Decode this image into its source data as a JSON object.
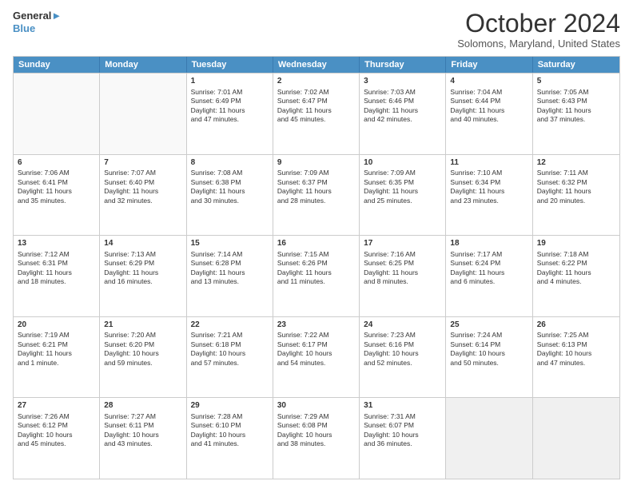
{
  "logo": {
    "line1": "General",
    "line2": "Blue"
  },
  "title": "October 2024",
  "subtitle": "Solomons, Maryland, United States",
  "headers": [
    "Sunday",
    "Monday",
    "Tuesday",
    "Wednesday",
    "Thursday",
    "Friday",
    "Saturday"
  ],
  "rows": [
    [
      {
        "day": "",
        "lines": [],
        "empty": true
      },
      {
        "day": "",
        "lines": [],
        "empty": true
      },
      {
        "day": "1",
        "lines": [
          "Sunrise: 7:01 AM",
          "Sunset: 6:49 PM",
          "Daylight: 11 hours",
          "and 47 minutes."
        ]
      },
      {
        "day": "2",
        "lines": [
          "Sunrise: 7:02 AM",
          "Sunset: 6:47 PM",
          "Daylight: 11 hours",
          "and 45 minutes."
        ]
      },
      {
        "day": "3",
        "lines": [
          "Sunrise: 7:03 AM",
          "Sunset: 6:46 PM",
          "Daylight: 11 hours",
          "and 42 minutes."
        ]
      },
      {
        "day": "4",
        "lines": [
          "Sunrise: 7:04 AM",
          "Sunset: 6:44 PM",
          "Daylight: 11 hours",
          "and 40 minutes."
        ]
      },
      {
        "day": "5",
        "lines": [
          "Sunrise: 7:05 AM",
          "Sunset: 6:43 PM",
          "Daylight: 11 hours",
          "and 37 minutes."
        ]
      }
    ],
    [
      {
        "day": "6",
        "lines": [
          "Sunrise: 7:06 AM",
          "Sunset: 6:41 PM",
          "Daylight: 11 hours",
          "and 35 minutes."
        ]
      },
      {
        "day": "7",
        "lines": [
          "Sunrise: 7:07 AM",
          "Sunset: 6:40 PM",
          "Daylight: 11 hours",
          "and 32 minutes."
        ]
      },
      {
        "day": "8",
        "lines": [
          "Sunrise: 7:08 AM",
          "Sunset: 6:38 PM",
          "Daylight: 11 hours",
          "and 30 minutes."
        ]
      },
      {
        "day": "9",
        "lines": [
          "Sunrise: 7:09 AM",
          "Sunset: 6:37 PM",
          "Daylight: 11 hours",
          "and 28 minutes."
        ]
      },
      {
        "day": "10",
        "lines": [
          "Sunrise: 7:09 AM",
          "Sunset: 6:35 PM",
          "Daylight: 11 hours",
          "and 25 minutes."
        ]
      },
      {
        "day": "11",
        "lines": [
          "Sunrise: 7:10 AM",
          "Sunset: 6:34 PM",
          "Daylight: 11 hours",
          "and 23 minutes."
        ]
      },
      {
        "day": "12",
        "lines": [
          "Sunrise: 7:11 AM",
          "Sunset: 6:32 PM",
          "Daylight: 11 hours",
          "and 20 minutes."
        ]
      }
    ],
    [
      {
        "day": "13",
        "lines": [
          "Sunrise: 7:12 AM",
          "Sunset: 6:31 PM",
          "Daylight: 11 hours",
          "and 18 minutes."
        ]
      },
      {
        "day": "14",
        "lines": [
          "Sunrise: 7:13 AM",
          "Sunset: 6:29 PM",
          "Daylight: 11 hours",
          "and 16 minutes."
        ]
      },
      {
        "day": "15",
        "lines": [
          "Sunrise: 7:14 AM",
          "Sunset: 6:28 PM",
          "Daylight: 11 hours",
          "and 13 minutes."
        ]
      },
      {
        "day": "16",
        "lines": [
          "Sunrise: 7:15 AM",
          "Sunset: 6:26 PM",
          "Daylight: 11 hours",
          "and 11 minutes."
        ]
      },
      {
        "day": "17",
        "lines": [
          "Sunrise: 7:16 AM",
          "Sunset: 6:25 PM",
          "Daylight: 11 hours",
          "and 8 minutes."
        ]
      },
      {
        "day": "18",
        "lines": [
          "Sunrise: 7:17 AM",
          "Sunset: 6:24 PM",
          "Daylight: 11 hours",
          "and 6 minutes."
        ]
      },
      {
        "day": "19",
        "lines": [
          "Sunrise: 7:18 AM",
          "Sunset: 6:22 PM",
          "Daylight: 11 hours",
          "and 4 minutes."
        ]
      }
    ],
    [
      {
        "day": "20",
        "lines": [
          "Sunrise: 7:19 AM",
          "Sunset: 6:21 PM",
          "Daylight: 11 hours",
          "and 1 minute."
        ]
      },
      {
        "day": "21",
        "lines": [
          "Sunrise: 7:20 AM",
          "Sunset: 6:20 PM",
          "Daylight: 10 hours",
          "and 59 minutes."
        ]
      },
      {
        "day": "22",
        "lines": [
          "Sunrise: 7:21 AM",
          "Sunset: 6:18 PM",
          "Daylight: 10 hours",
          "and 57 minutes."
        ]
      },
      {
        "day": "23",
        "lines": [
          "Sunrise: 7:22 AM",
          "Sunset: 6:17 PM",
          "Daylight: 10 hours",
          "and 54 minutes."
        ]
      },
      {
        "day": "24",
        "lines": [
          "Sunrise: 7:23 AM",
          "Sunset: 6:16 PM",
          "Daylight: 10 hours",
          "and 52 minutes."
        ]
      },
      {
        "day": "25",
        "lines": [
          "Sunrise: 7:24 AM",
          "Sunset: 6:14 PM",
          "Daylight: 10 hours",
          "and 50 minutes."
        ]
      },
      {
        "day": "26",
        "lines": [
          "Sunrise: 7:25 AM",
          "Sunset: 6:13 PM",
          "Daylight: 10 hours",
          "and 47 minutes."
        ]
      }
    ],
    [
      {
        "day": "27",
        "lines": [
          "Sunrise: 7:26 AM",
          "Sunset: 6:12 PM",
          "Daylight: 10 hours",
          "and 45 minutes."
        ]
      },
      {
        "day": "28",
        "lines": [
          "Sunrise: 7:27 AM",
          "Sunset: 6:11 PM",
          "Daylight: 10 hours",
          "and 43 minutes."
        ]
      },
      {
        "day": "29",
        "lines": [
          "Sunrise: 7:28 AM",
          "Sunset: 6:10 PM",
          "Daylight: 10 hours",
          "and 41 minutes."
        ]
      },
      {
        "day": "30",
        "lines": [
          "Sunrise: 7:29 AM",
          "Sunset: 6:08 PM",
          "Daylight: 10 hours",
          "and 38 minutes."
        ]
      },
      {
        "day": "31",
        "lines": [
          "Sunrise: 7:31 AM",
          "Sunset: 6:07 PM",
          "Daylight: 10 hours",
          "and 36 minutes."
        ]
      },
      {
        "day": "",
        "lines": [],
        "empty": true,
        "shaded": true
      },
      {
        "day": "",
        "lines": [],
        "empty": true,
        "shaded": true
      }
    ]
  ]
}
